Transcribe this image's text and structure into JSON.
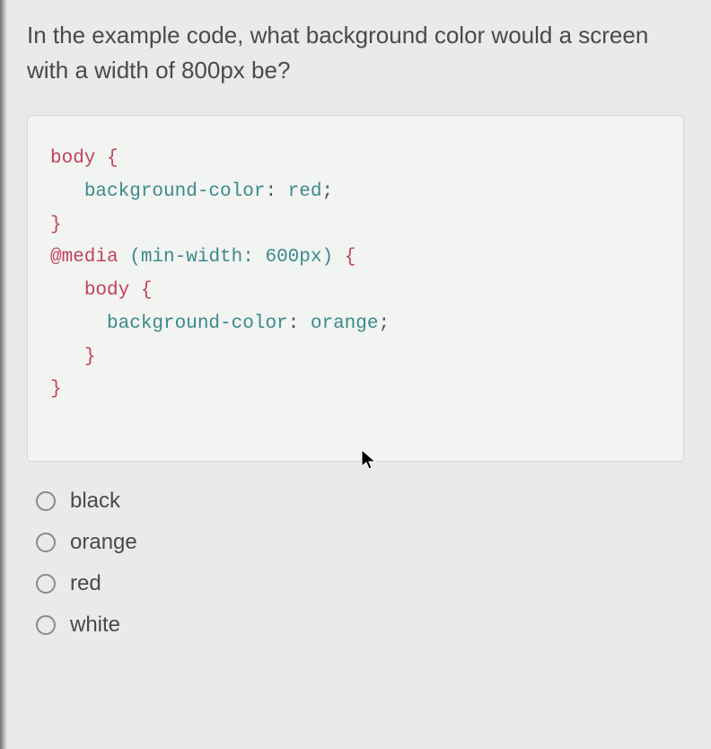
{
  "question": "In the example code, what background color would a screen with a width of 800px be?",
  "code": {
    "line1_selector": "body",
    "line1_brace": " {",
    "line2_indent": "   ",
    "line2_prop": "background-color",
    "line2_colon": ": ",
    "line2_val": "red",
    "line2_semi": ";",
    "line3": "}",
    "blank": "",
    "line4_at": "@media",
    "line4_space": " ",
    "line4_paren_open": "(",
    "line4_cond": "min-width: 600px",
    "line4_paren_close": ")",
    "line4_brace": " {",
    "line5_indent": "   ",
    "line5_selector": "body",
    "line5_brace": " {",
    "line6_indent": "     ",
    "line6_prop": "background-color",
    "line6_colon": ": ",
    "line6_val": "orange",
    "line6_semi": ";",
    "line7_indent": "   ",
    "line7": "}",
    "line8": "}"
  },
  "options": [
    {
      "label": "black"
    },
    {
      "label": "orange"
    },
    {
      "label": "red"
    },
    {
      "label": "white"
    }
  ]
}
